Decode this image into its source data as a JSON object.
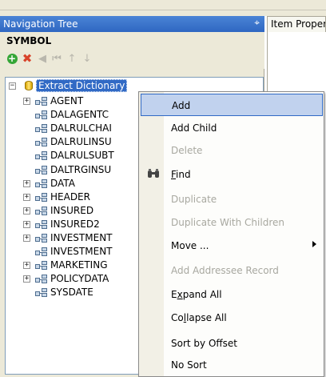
{
  "navigation": {
    "title": "Navigation Tree",
    "pin_glyph": "⌖",
    "symbol_label": "SYMBOL",
    "toolbar": {
      "add_icon": "+",
      "delete_icon": "✖",
      "prev_icon": "◀",
      "first_icon": "⏮",
      "up_icon": "↑",
      "down_icon": "↓"
    },
    "root": {
      "label": "Extract Dictionary",
      "expanded": "−"
    },
    "items": [
      {
        "label": "AGENT",
        "expander": "+"
      },
      {
        "label": "DALAGENTC",
        "expander": ""
      },
      {
        "label": "DALRULCHAI",
        "expander": ""
      },
      {
        "label": "DALRULINSU",
        "expander": ""
      },
      {
        "label": "DALRULSUBT",
        "expander": ""
      },
      {
        "label": "DALTRGINSU",
        "expander": ""
      },
      {
        "label": "DATA",
        "expander": "+"
      },
      {
        "label": "HEADER",
        "expander": "+"
      },
      {
        "label": "INSURED",
        "expander": "+"
      },
      {
        "label": "INSURED2",
        "expander": "+"
      },
      {
        "label": "INVESTMENT",
        "expander": "+"
      },
      {
        "label": "INVESTMENT",
        "expander": ""
      },
      {
        "label": "MARKETING",
        "expander": "+"
      },
      {
        "label": "POLICYDATA",
        "expander": "+"
      },
      {
        "label": "SYSDATE",
        "expander": ""
      }
    ]
  },
  "item_properties": {
    "tab_label": "Item Proper"
  },
  "context_menu": {
    "items": [
      {
        "label": "Add",
        "enabled": "true",
        "hover": "true"
      },
      {
        "label": "Add Child",
        "enabled": "true"
      },
      {
        "label": "Delete",
        "enabled": "false"
      },
      {
        "label_prefix": "",
        "label_under": "F",
        "label_rest": "ind",
        "enabled": "true",
        "icon": "binoculars-icon"
      },
      {
        "label": "Duplicate",
        "enabled": "false"
      },
      {
        "label": "Duplicate With Children",
        "enabled": "false"
      },
      {
        "label": "Move ...",
        "enabled": "true",
        "submenu": "true"
      },
      {
        "label": "Add Addressee Record",
        "enabled": "false"
      },
      {
        "label_prefix": "E",
        "label_under": "x",
        "label_rest": "pand All",
        "enabled": "true"
      },
      {
        "label_prefix": "Co",
        "label_under": "l",
        "label_rest": "lapse All",
        "enabled": "true"
      },
      {
        "label": "Sort by Offset",
        "enabled": "true"
      },
      {
        "label": "No Sort",
        "enabled": "true"
      }
    ]
  }
}
